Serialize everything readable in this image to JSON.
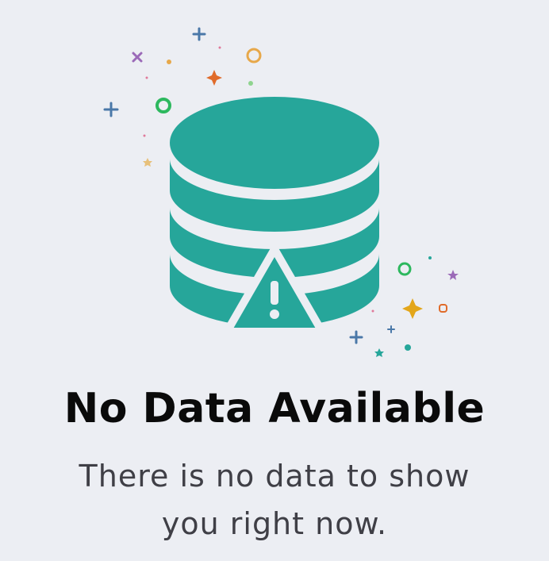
{
  "empty_state": {
    "title": "No Data Available",
    "message": "There is no data to show you right now.",
    "illustration": {
      "icon": "database-warning-icon",
      "primary_color": "#26a69a",
      "warning_glyph": "!"
    }
  },
  "colors": {
    "background": "#eceef3",
    "title": "#0a0a0a",
    "message": "#3f3f46",
    "confetti": [
      "#4a78a8",
      "#e7a84a",
      "#9b6ab8",
      "#e06b2a",
      "#2db85e",
      "#f0a0a8",
      "#e3a61a",
      "#26a69a"
    ]
  }
}
